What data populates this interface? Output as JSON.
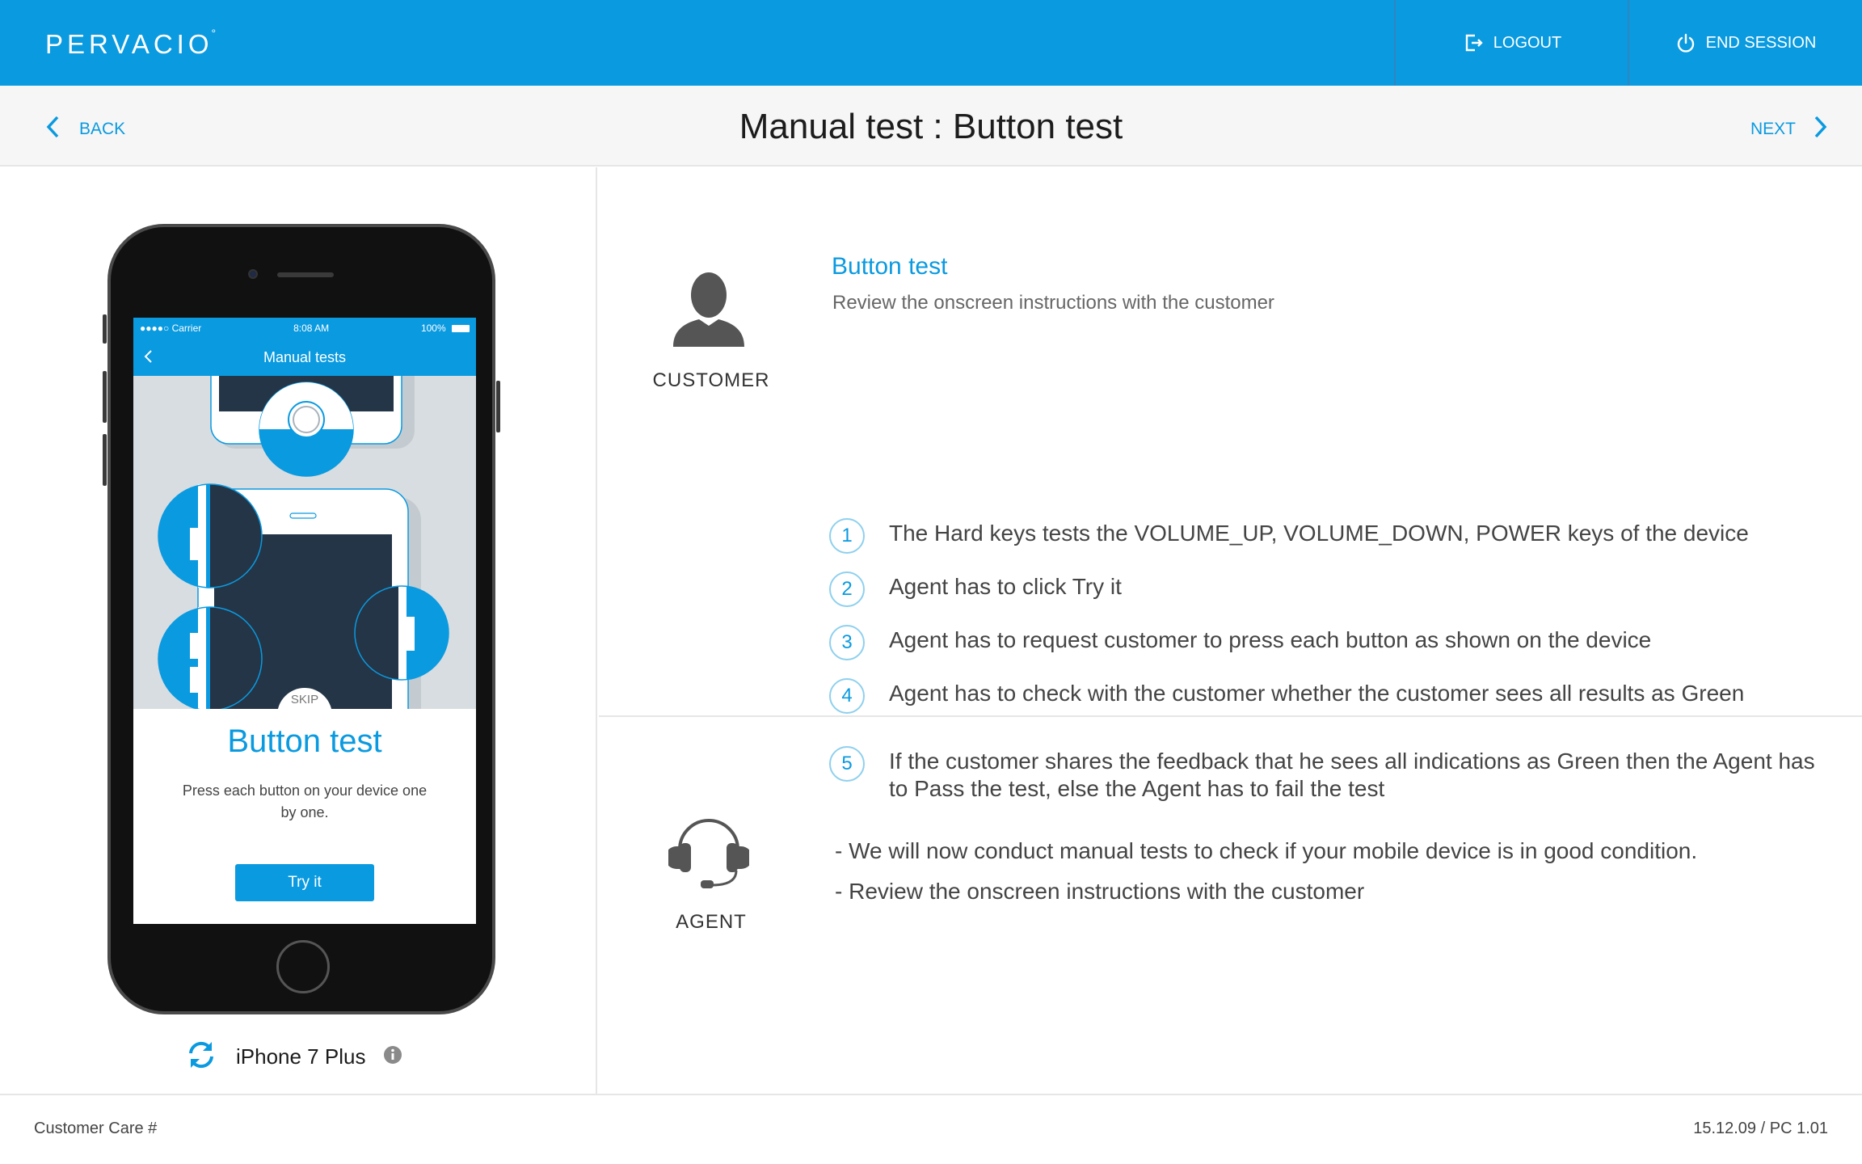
{
  "header": {
    "logo": "PERVACIO",
    "logo_mark": "°",
    "logout_label": "LOGOUT",
    "end_session_label": "END SESSION"
  },
  "subheader": {
    "back_label": "BACK",
    "title": "Manual test : Button test",
    "next_label": "NEXT"
  },
  "phone_screen": {
    "carrier": "●●●●○ Carrier",
    "time": "8:08 AM",
    "battery": "100%",
    "nav_title": "Manual tests",
    "skip_label": "SKIP",
    "title": "Button test",
    "description": "Press each button on your device one by one.",
    "try_label": "Try it"
  },
  "device": {
    "name": "iPhone 7 Plus"
  },
  "customer": {
    "role_label": "CUSTOMER",
    "title": "Button test",
    "subtitle": "Review the onscreen instructions with the customer",
    "steps": [
      {
        "num": "1",
        "text": "The Hard keys tests the VOLUME_UP, VOLUME_DOWN, POWER keys of the device"
      },
      {
        "num": "2",
        "text": "Agent has to click Try it"
      },
      {
        "num": "3",
        "text": "Agent has to request customer to press each button as shown on the device"
      },
      {
        "num": "4",
        "text": "Agent has to check with the customer whether the customer sees all results as Green"
      },
      {
        "num": "5",
        "text": "If the customer shares the feedback that he sees all indications as Green then the Agent has to Pass the test, else the Agent has to fail the test"
      }
    ]
  },
  "agent": {
    "role_label": "AGENT",
    "lines": [
      "- We will now conduct manual tests to check if your mobile device is in good condition.",
      "- Review the onscreen instructions with the customer"
    ]
  },
  "footer": {
    "left": "Customer Care #",
    "right": "15.12.09 / PC 1.01"
  },
  "colors": {
    "brand": "#0a9ae0",
    "illustration_bg": "#d8dde1",
    "device_dark": "#243547"
  },
  "icons": {
    "logout": "logout-icon",
    "end_session": "power-icon",
    "back": "chevron-left-icon",
    "next": "chevron-right-icon",
    "refresh": "refresh-icon",
    "info": "info-icon",
    "customer": "person-icon",
    "agent": "headset-icon"
  }
}
